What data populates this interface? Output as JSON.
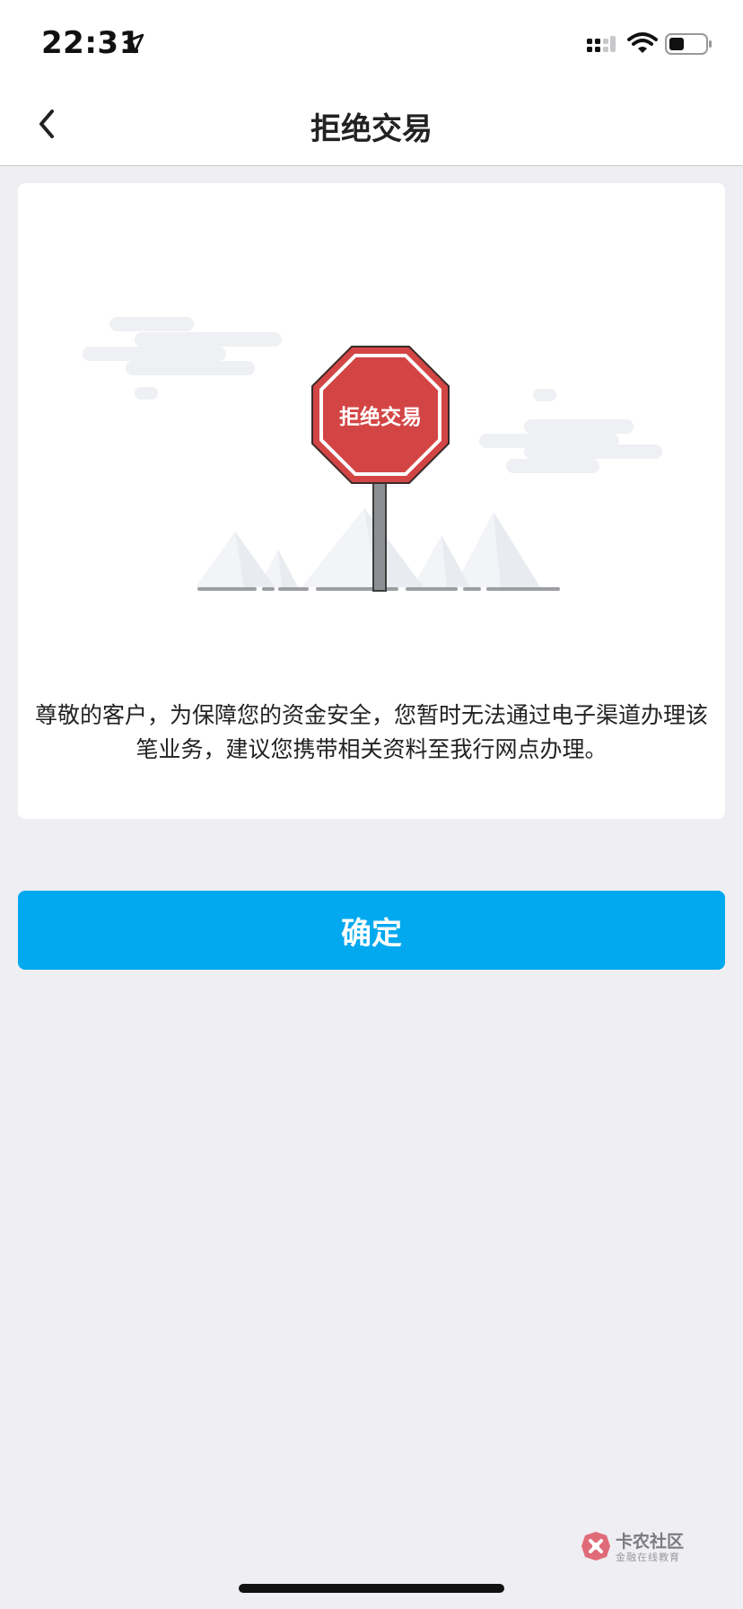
{
  "status_bar": {
    "time": "22:31",
    "icons": [
      "location-arrow-icon",
      "signal-icon",
      "wifi-icon",
      "battery-icon"
    ]
  },
  "nav": {
    "back_icon": "chevron-left-icon",
    "title": "拒绝交易"
  },
  "card": {
    "sign_label": "拒绝交易",
    "message": "尊敬的客户，为保障您的资金安全，您暂时无法通过电子渠道办理该笔业务，建议您携带相关资料至我行网点办理。"
  },
  "confirm_label": "确定",
  "watermark": {
    "title": "卡农社区",
    "subtitle": "金融在线教育"
  },
  "colors": {
    "accent": "#02a9ef",
    "sign_red": "#d34545",
    "background": "#eeeef3"
  }
}
